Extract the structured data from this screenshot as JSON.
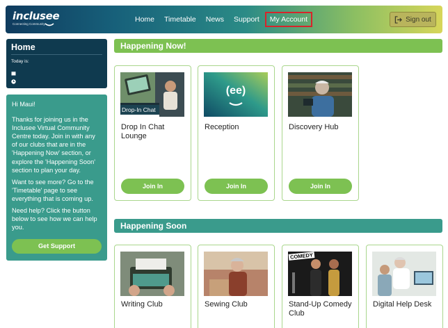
{
  "header": {
    "logo_text": "inclusee",
    "logo_tagline": "Connecting Community",
    "nav": [
      "Home",
      "Timetable",
      "News",
      "Support",
      "My Account"
    ],
    "active_nav": "My Account",
    "signout_label": "Sign out"
  },
  "home_panel": {
    "title": "Home",
    "today_label": "Today is:"
  },
  "welcome": {
    "greeting": "Hi Maui!",
    "paragraphs": [
      "Thanks for joining us in the Inclusee Virtual Community Centre today. Join in with any of our clubs that are in the 'Happening Now' section, or explore the 'Happening Soon' section to plan your day.",
      "Want to see more? Go to the 'Timetable' page to see everything that is coming up.",
      "Need help? Click the button below to see how we can help you."
    ],
    "button_label": "Get Support"
  },
  "happening_now": {
    "title": "Happening Now!",
    "cards": [
      {
        "title": "Drop In Chat Lounge",
        "thumb_text": "Drop-In Chat",
        "button": "Join In"
      },
      {
        "title": "Reception",
        "thumb_text": "(ee)",
        "button": "Join In"
      },
      {
        "title": "Discovery Hub",
        "button": "Join In"
      }
    ]
  },
  "happening_soon": {
    "title": "Happening Soon",
    "cards": [
      {
        "title": "Writing Club"
      },
      {
        "title": "Sewing Club"
      },
      {
        "title": "Stand-Up Comedy Club",
        "thumb_text": "COMEDY"
      },
      {
        "title": "Digital Help Desk"
      }
    ]
  },
  "colors": {
    "green": "#7dc152",
    "teal": "#3a9b8c",
    "navy": "#0f3a4f",
    "active_border": "#d8242a"
  }
}
